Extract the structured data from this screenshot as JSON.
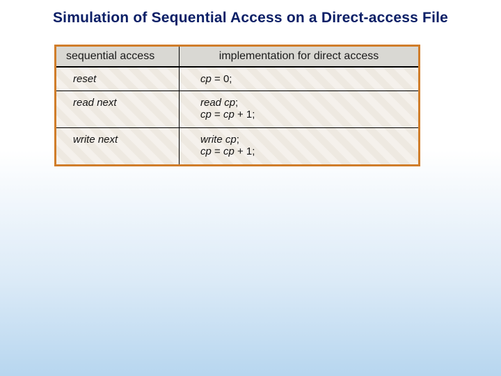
{
  "title": "Simulation of Sequential Access on a Direct-access File",
  "chart_data": {
    "type": "table",
    "columns": [
      "sequential access",
      "implementation for direct access"
    ],
    "rows": [
      {
        "op": "reset",
        "impl": [
          "cp = 0;"
        ]
      },
      {
        "op": "read next",
        "impl": [
          "read cp;",
          "cp = cp + 1;"
        ]
      },
      {
        "op": "write next",
        "impl": [
          "write cp;",
          "cp = cp + 1;"
        ]
      }
    ]
  },
  "table": {
    "head_left": "sequential access",
    "head_right": "implementation for direct access",
    "r1_left": "reset",
    "r1_a_it": "cp",
    "r1_a_rest": " = 0;",
    "r2_left": "read next",
    "r2_a_it": "read cp",
    "r2_a_rest": ";",
    "r2_b_it1": "cp",
    "r2_b_mid": " = ",
    "r2_b_it2": "cp",
    "r2_b_rest": " + 1;",
    "r3_left": "write next",
    "r3_a_it": "write cp",
    "r3_a_rest": ";",
    "r3_b_it1": "cp",
    "r3_b_mid": " = ",
    "r3_b_it2": "cp",
    "r3_b_rest": " + 1;"
  }
}
